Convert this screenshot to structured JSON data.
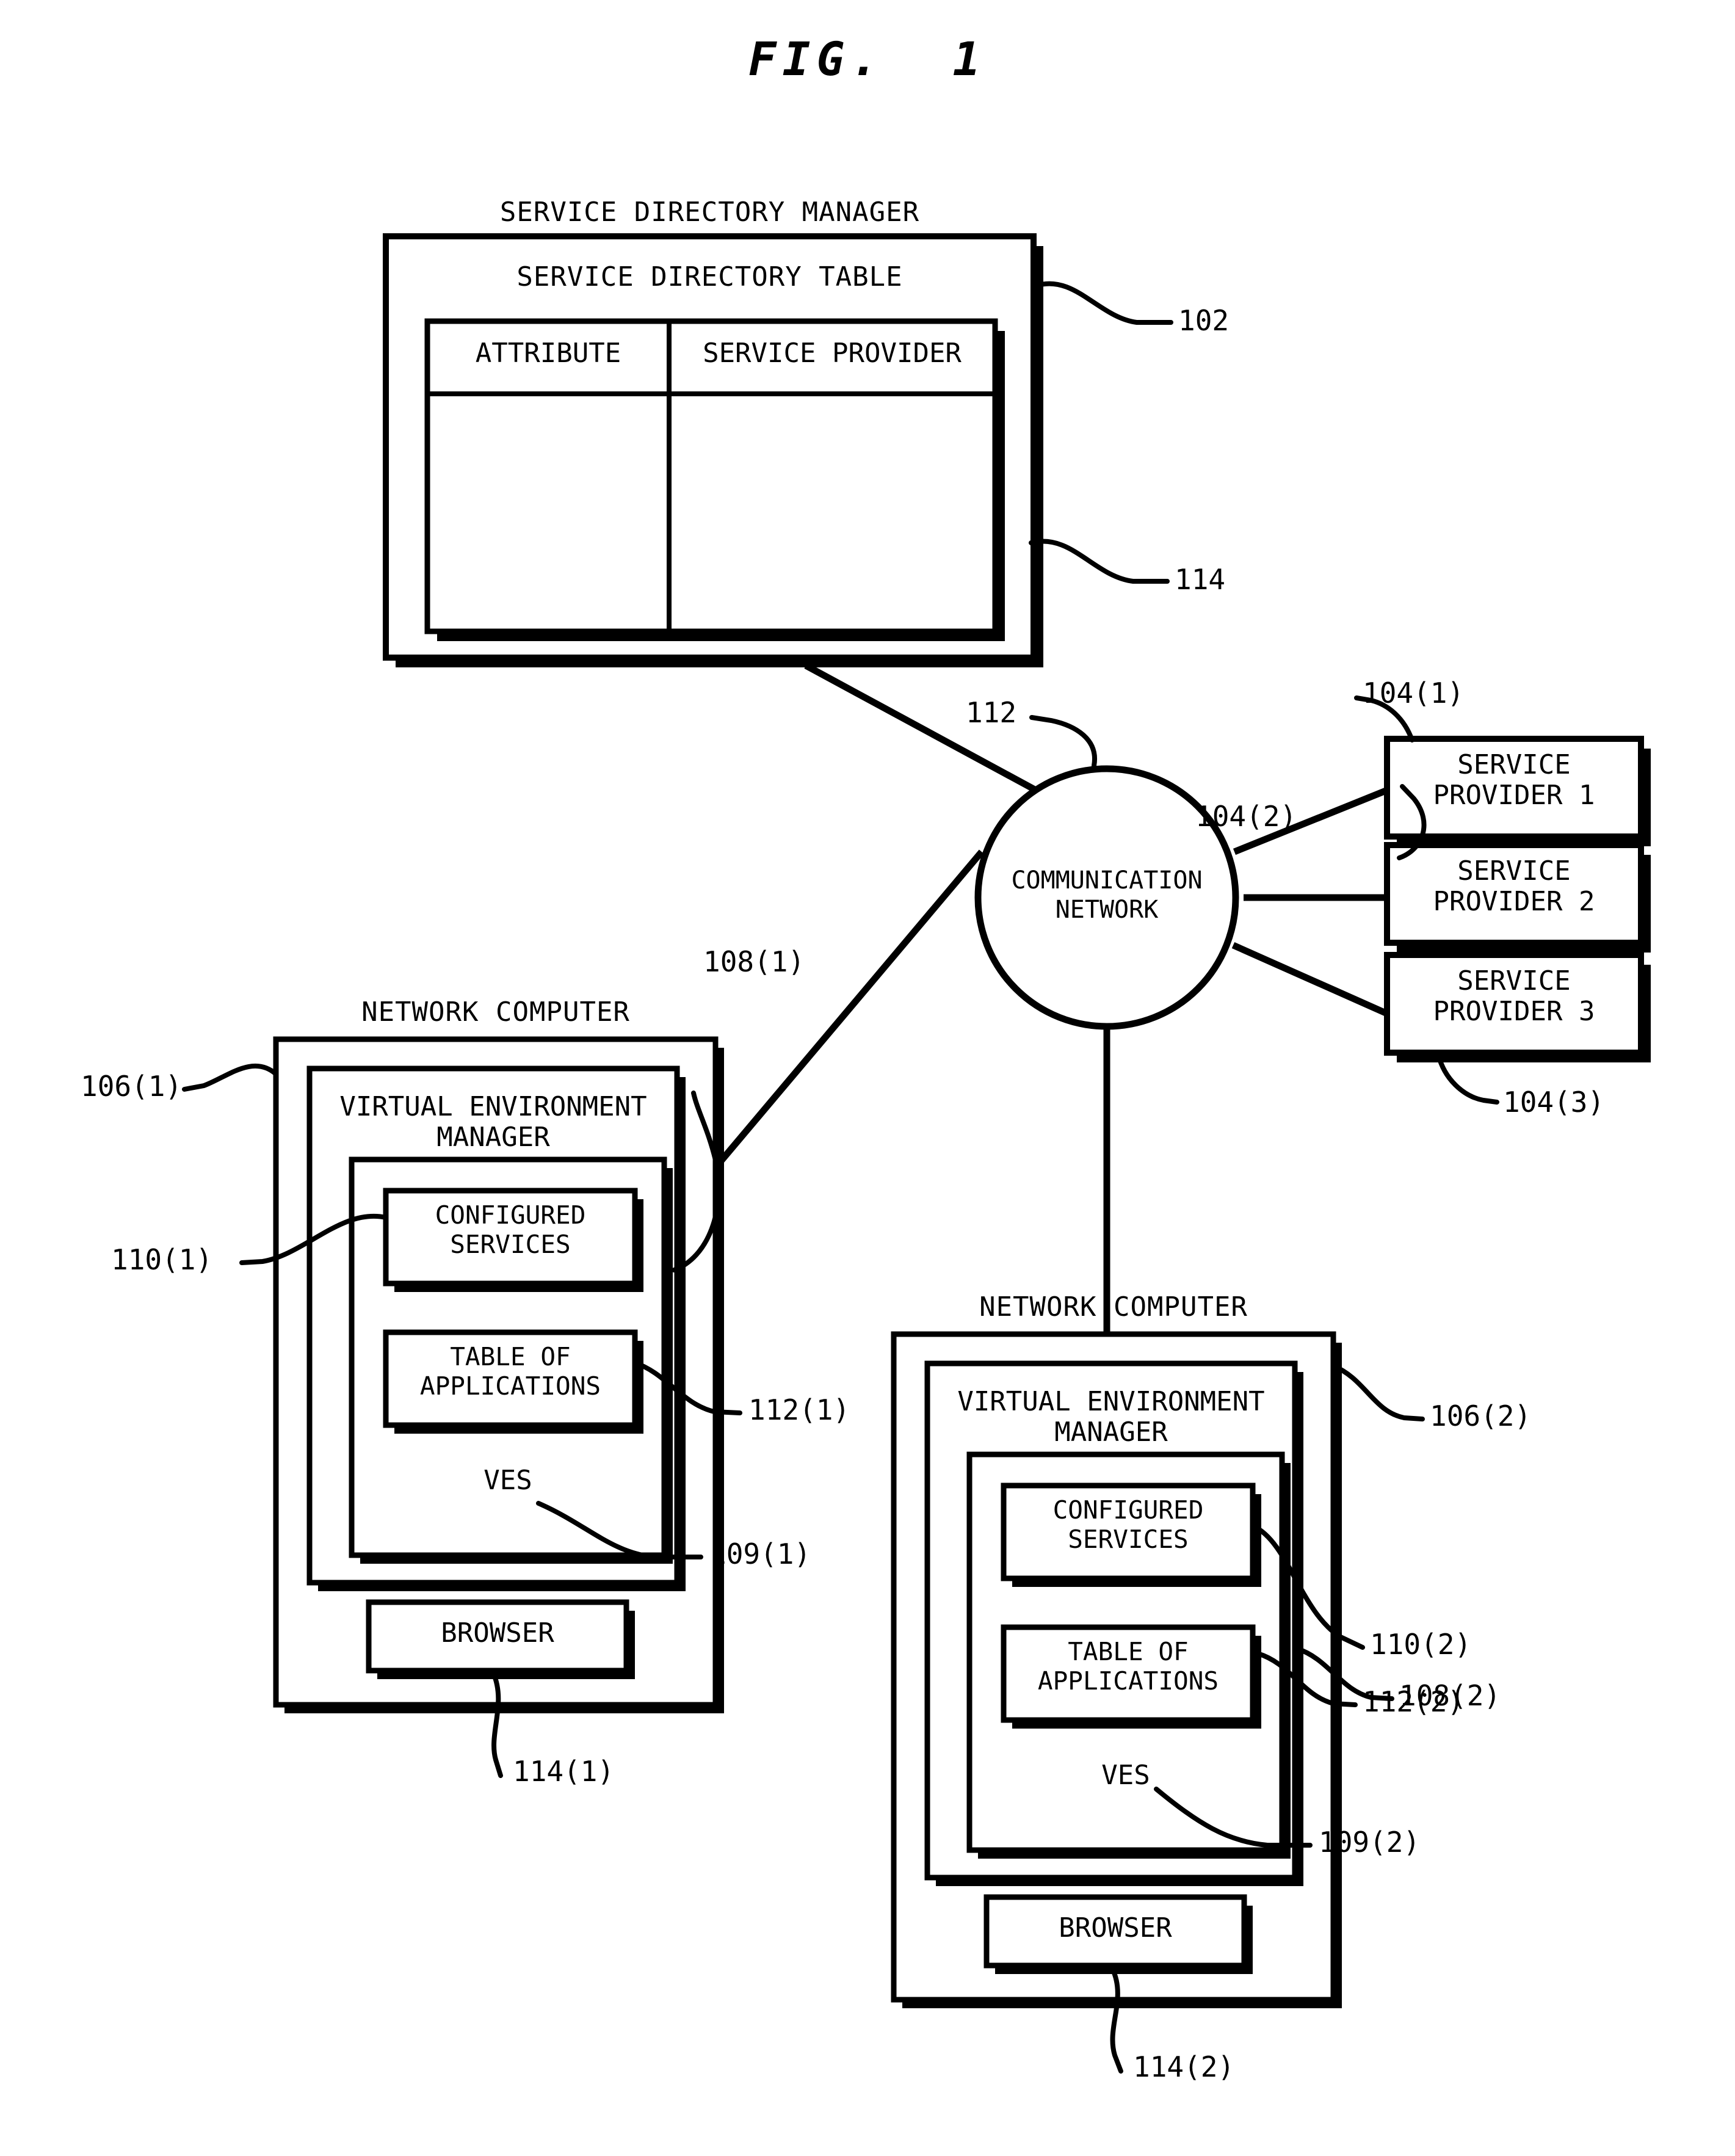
{
  "figure": {
    "title": "FIG.  1"
  },
  "service_directory_manager": {
    "caption": "SERVICE DIRECTORY MANAGER",
    "table_title": "SERVICE DIRECTORY TABLE",
    "columns": [
      "ATTRIBUTE",
      "SERVICE PROVIDER"
    ],
    "rows": [
      [
        "",
        ""
      ]
    ],
    "ref_manager": "102",
    "ref_table": "114"
  },
  "communication_network": {
    "label_line1": "COMMUNICATION",
    "label_line2": "NETWORK",
    "ref": "112"
  },
  "service_providers": [
    {
      "label_line1": "SERVICE",
      "label_line2": "PROVIDER 1",
      "ref": "104(1)"
    },
    {
      "label_line1": "SERVICE",
      "label_line2": "PROVIDER 2",
      "ref": "104(2)"
    },
    {
      "label_line1": "SERVICE",
      "label_line2": "PROVIDER 3",
      "ref": "104(3)"
    }
  ],
  "network_computers": [
    {
      "caption": "NETWORK COMPUTER",
      "ref_computer": "106(1)",
      "vem_line1": "VIRTUAL ENVIRONMENT",
      "vem_line2": "MANAGER",
      "ref_vem": "108(1)",
      "configured_services_line1": "CONFIGURED",
      "configured_services_line2": "SERVICES",
      "ref_configured_services": "110(1)",
      "table_of_applications_line1": "TABLE OF",
      "table_of_applications_line2": "APPLICATIONS",
      "ref_table_of_applications": "112(1)",
      "ves_label": "VES",
      "ref_ves": "109(1)",
      "browser_label": "BROWSER",
      "ref_browser": "114(1)"
    },
    {
      "caption": "NETWORK COMPUTER",
      "ref_computer": "106(2)",
      "vem_line1": "VIRTUAL ENVIRONMENT",
      "vem_line2": "MANAGER",
      "ref_vem": "108(2)",
      "configured_services_line1": "CONFIGURED",
      "configured_services_line2": "SERVICES",
      "ref_configured_services": "110(2)",
      "table_of_applications_line1": "TABLE OF",
      "table_of_applications_line2": "APPLICATIONS",
      "ref_table_of_applications": "112(2)",
      "ves_label": "VES",
      "ref_ves": "109(2)",
      "browser_label": "BROWSER",
      "ref_browser": "114(2)"
    }
  ],
  "colors": {
    "ink": "#000000",
    "paper": "#ffffff"
  }
}
